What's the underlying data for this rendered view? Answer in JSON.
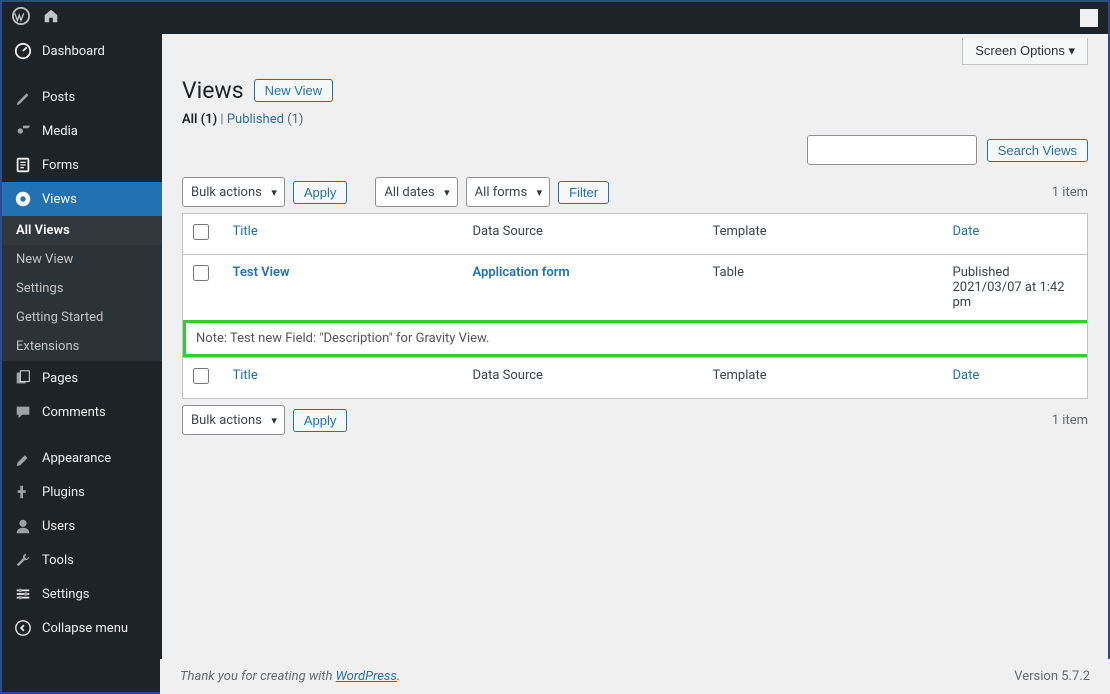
{
  "topbar": {},
  "screen_options": "Screen Options ▾",
  "page": {
    "title": "Views",
    "new_button": "New View"
  },
  "subsubsub": {
    "all_label": "All",
    "all_count": "(1)",
    "sep": " | ",
    "pub_label": "Published",
    "pub_count": "(1)"
  },
  "search": {
    "button": "Search Views"
  },
  "filters": {
    "bulk": "Bulk actions",
    "apply": "Apply",
    "dates": "All dates",
    "forms": "All forms",
    "filter": "Filter",
    "count": "1 item"
  },
  "columns": {
    "title": "Title",
    "source": "Data Source",
    "template": "Template",
    "date": "Date"
  },
  "row": {
    "title": "Test View",
    "source": "Application form",
    "template": "Table",
    "date": "Published\n2021/03/07 at 1:42 pm"
  },
  "note": "Note: Test new Field: \"Description\" for Gravity View.",
  "sidebar": {
    "items": [
      {
        "label": "Dashboard"
      },
      {
        "label": "Posts"
      },
      {
        "label": "Media"
      },
      {
        "label": "Forms"
      },
      {
        "label": "Views"
      },
      {
        "label": "Pages"
      },
      {
        "label": "Comments"
      },
      {
        "label": "Appearance"
      },
      {
        "label": "Plugins"
      },
      {
        "label": "Users"
      },
      {
        "label": "Tools"
      },
      {
        "label": "Settings"
      },
      {
        "label": "Collapse menu"
      }
    ],
    "sub": [
      {
        "label": "All Views"
      },
      {
        "label": "New View"
      },
      {
        "label": "Settings"
      },
      {
        "label": "Getting Started"
      },
      {
        "label": "Extensions"
      }
    ]
  },
  "footer": {
    "thanks": "Thank you for creating with ",
    "wp": "WordPress",
    "dot": ".",
    "version": "Version 5.7.2"
  }
}
